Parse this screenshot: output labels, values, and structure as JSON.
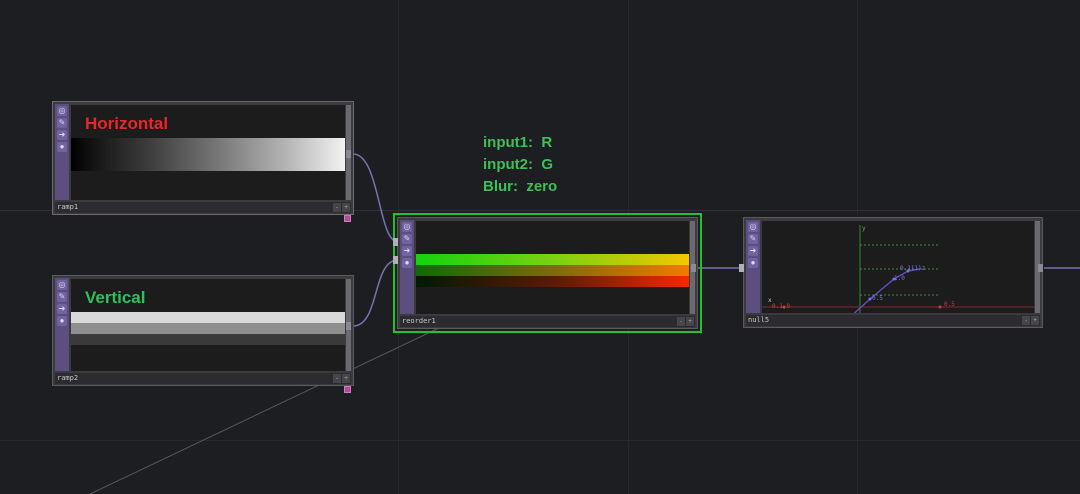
{
  "nodes": {
    "ramp1": {
      "name": "ramp1",
      "title": "Horizontal",
      "title_color": "#e8262b"
    },
    "ramp2": {
      "name": "ramp2",
      "title": "Vertical",
      "title_color": "#2cc15a"
    },
    "reorder1": {
      "name": "reorder1"
    },
    "null5": {
      "name": "null5"
    }
  },
  "annotation": {
    "line1": "input1:  R",
    "line2": "input2:  G",
    "line3": "Blur:  zero"
  },
  "graph_labels": {
    "y": "y",
    "x": "x",
    "zero_a": "0.1,0",
    "zero_b": "0.5",
    "p1": "0.5",
    "p2": "1.0",
    "p3": "0.1(1)z",
    "p4": "1.0",
    "p5": "1.0"
  },
  "colors": {
    "accent_selected": "#22c22a",
    "node_side": "#5c4f80",
    "wire": "#7b6fb0"
  }
}
